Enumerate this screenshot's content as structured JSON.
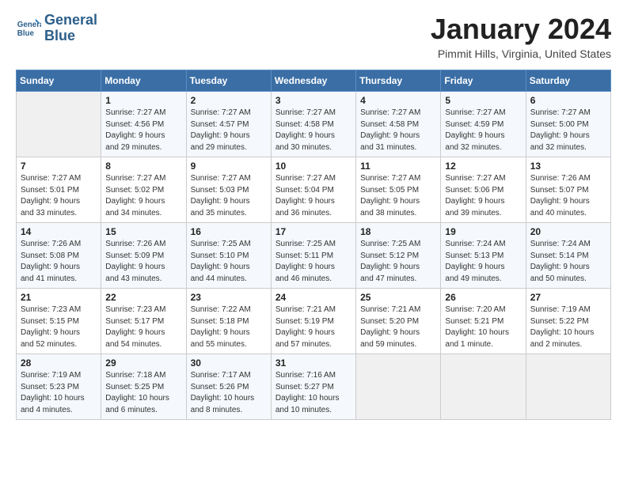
{
  "logo": {
    "line1": "General",
    "line2": "Blue"
  },
  "title": "January 2024",
  "location": "Pimmit Hills, Virginia, United States",
  "header_days": [
    "Sunday",
    "Monday",
    "Tuesday",
    "Wednesday",
    "Thursday",
    "Friday",
    "Saturday"
  ],
  "weeks": [
    [
      {
        "day": "",
        "info": ""
      },
      {
        "day": "1",
        "info": "Sunrise: 7:27 AM\nSunset: 4:56 PM\nDaylight: 9 hours\nand 29 minutes."
      },
      {
        "day": "2",
        "info": "Sunrise: 7:27 AM\nSunset: 4:57 PM\nDaylight: 9 hours\nand 29 minutes."
      },
      {
        "day": "3",
        "info": "Sunrise: 7:27 AM\nSunset: 4:58 PM\nDaylight: 9 hours\nand 30 minutes."
      },
      {
        "day": "4",
        "info": "Sunrise: 7:27 AM\nSunset: 4:58 PM\nDaylight: 9 hours\nand 31 minutes."
      },
      {
        "day": "5",
        "info": "Sunrise: 7:27 AM\nSunset: 4:59 PM\nDaylight: 9 hours\nand 32 minutes."
      },
      {
        "day": "6",
        "info": "Sunrise: 7:27 AM\nSunset: 5:00 PM\nDaylight: 9 hours\nand 32 minutes."
      }
    ],
    [
      {
        "day": "7",
        "info": "Sunrise: 7:27 AM\nSunset: 5:01 PM\nDaylight: 9 hours\nand 33 minutes."
      },
      {
        "day": "8",
        "info": "Sunrise: 7:27 AM\nSunset: 5:02 PM\nDaylight: 9 hours\nand 34 minutes."
      },
      {
        "day": "9",
        "info": "Sunrise: 7:27 AM\nSunset: 5:03 PM\nDaylight: 9 hours\nand 35 minutes."
      },
      {
        "day": "10",
        "info": "Sunrise: 7:27 AM\nSunset: 5:04 PM\nDaylight: 9 hours\nand 36 minutes."
      },
      {
        "day": "11",
        "info": "Sunrise: 7:27 AM\nSunset: 5:05 PM\nDaylight: 9 hours\nand 38 minutes."
      },
      {
        "day": "12",
        "info": "Sunrise: 7:27 AM\nSunset: 5:06 PM\nDaylight: 9 hours\nand 39 minutes."
      },
      {
        "day": "13",
        "info": "Sunrise: 7:26 AM\nSunset: 5:07 PM\nDaylight: 9 hours\nand 40 minutes."
      }
    ],
    [
      {
        "day": "14",
        "info": "Sunrise: 7:26 AM\nSunset: 5:08 PM\nDaylight: 9 hours\nand 41 minutes."
      },
      {
        "day": "15",
        "info": "Sunrise: 7:26 AM\nSunset: 5:09 PM\nDaylight: 9 hours\nand 43 minutes."
      },
      {
        "day": "16",
        "info": "Sunrise: 7:25 AM\nSunset: 5:10 PM\nDaylight: 9 hours\nand 44 minutes."
      },
      {
        "day": "17",
        "info": "Sunrise: 7:25 AM\nSunset: 5:11 PM\nDaylight: 9 hours\nand 46 minutes."
      },
      {
        "day": "18",
        "info": "Sunrise: 7:25 AM\nSunset: 5:12 PM\nDaylight: 9 hours\nand 47 minutes."
      },
      {
        "day": "19",
        "info": "Sunrise: 7:24 AM\nSunset: 5:13 PM\nDaylight: 9 hours\nand 49 minutes."
      },
      {
        "day": "20",
        "info": "Sunrise: 7:24 AM\nSunset: 5:14 PM\nDaylight: 9 hours\nand 50 minutes."
      }
    ],
    [
      {
        "day": "21",
        "info": "Sunrise: 7:23 AM\nSunset: 5:15 PM\nDaylight: 9 hours\nand 52 minutes."
      },
      {
        "day": "22",
        "info": "Sunrise: 7:23 AM\nSunset: 5:17 PM\nDaylight: 9 hours\nand 54 minutes."
      },
      {
        "day": "23",
        "info": "Sunrise: 7:22 AM\nSunset: 5:18 PM\nDaylight: 9 hours\nand 55 minutes."
      },
      {
        "day": "24",
        "info": "Sunrise: 7:21 AM\nSunset: 5:19 PM\nDaylight: 9 hours\nand 57 minutes."
      },
      {
        "day": "25",
        "info": "Sunrise: 7:21 AM\nSunset: 5:20 PM\nDaylight: 9 hours\nand 59 minutes."
      },
      {
        "day": "26",
        "info": "Sunrise: 7:20 AM\nSunset: 5:21 PM\nDaylight: 10 hours\nand 1 minute."
      },
      {
        "day": "27",
        "info": "Sunrise: 7:19 AM\nSunset: 5:22 PM\nDaylight: 10 hours\nand 2 minutes."
      }
    ],
    [
      {
        "day": "28",
        "info": "Sunrise: 7:19 AM\nSunset: 5:23 PM\nDaylight: 10 hours\nand 4 minutes."
      },
      {
        "day": "29",
        "info": "Sunrise: 7:18 AM\nSunset: 5:25 PM\nDaylight: 10 hours\nand 6 minutes."
      },
      {
        "day": "30",
        "info": "Sunrise: 7:17 AM\nSunset: 5:26 PM\nDaylight: 10 hours\nand 8 minutes."
      },
      {
        "day": "31",
        "info": "Sunrise: 7:16 AM\nSunset: 5:27 PM\nDaylight: 10 hours\nand 10 minutes."
      },
      {
        "day": "",
        "info": ""
      },
      {
        "day": "",
        "info": ""
      },
      {
        "day": "",
        "info": ""
      }
    ]
  ]
}
